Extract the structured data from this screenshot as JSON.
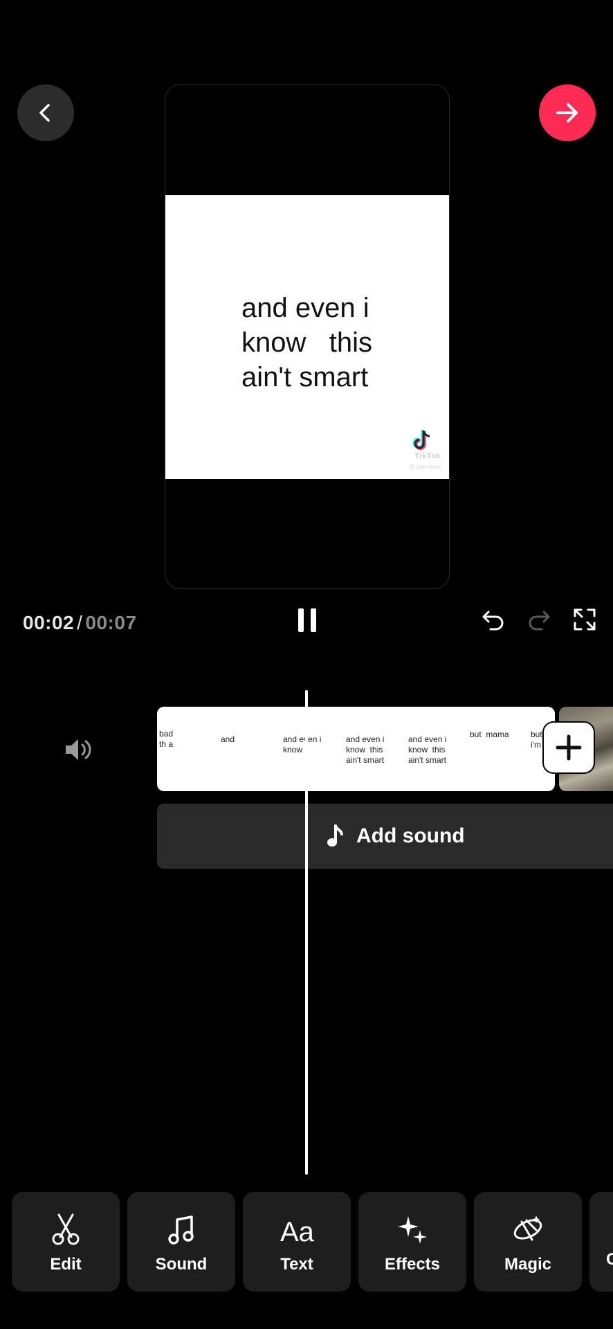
{
  "colors": {
    "accent": "#fe2c55",
    "background": "#000000",
    "panel": "#1e1e1e"
  },
  "top_bar": {
    "back_icon": "chevron-left-icon",
    "next_icon": "arrow-right-icon"
  },
  "preview": {
    "caption": "and even i\nknow   this\nain't smart",
    "watermark_text": "TikTok",
    "watermark_user": "@ username"
  },
  "playback": {
    "current_time": "00:02",
    "separator": "/",
    "total_time": "00:07"
  },
  "timeline": {
    "thumbnails": [
      "bad\nth a",
      "and",
      "and even i\nknow",
      "and even i\nknow  this\nain't smart",
      "and even i\nknow  this\nain't smart",
      "but  mama",
      "but  ma\ni'm  in"
    ],
    "add_sound_label": "Add sound"
  },
  "toolbar": [
    {
      "label": "Edit",
      "icon": "scissors-icon"
    },
    {
      "label": "Sound",
      "icon": "music-note-icon"
    },
    {
      "label": "Text",
      "icon": "text-aa-icon"
    },
    {
      "label": "Effects",
      "icon": "sparkles-icon"
    },
    {
      "label": "Magic",
      "icon": "magic-icon"
    },
    {
      "label": "C",
      "icon": "more-icon"
    }
  ]
}
